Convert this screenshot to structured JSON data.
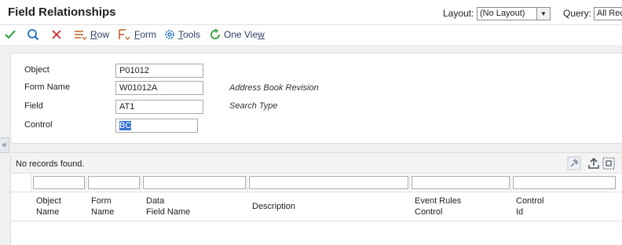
{
  "header": {
    "title": "Field Relationships",
    "layout_label": "Layout:",
    "layout_value": "(No Layout)",
    "query_label": "Query:",
    "query_value": "All Rec"
  },
  "toolbar": {
    "row_label": "Row",
    "form_label": "Form",
    "tools_label": "Tools",
    "oneview_label": "One View",
    "colors": {
      "check": "#2e9e3a",
      "search": "#1f6fc0",
      "close": "#d12b2b",
      "accent": "#c85a27"
    }
  },
  "form": {
    "fields": [
      {
        "label": "Object",
        "value": "P01012",
        "description": ""
      },
      {
        "label": "Form Name",
        "value": "W01012A",
        "description": "Address Book Revision"
      },
      {
        "label": "Field",
        "value": "AT1",
        "description": "Search Type"
      },
      {
        "label": "Control",
        "value": "BC",
        "description": ""
      }
    ]
  },
  "grid": {
    "status": "No records found.",
    "columns": [
      {
        "line1": "Object",
        "line2": "Name"
      },
      {
        "line1": "Form",
        "line2": "Name"
      },
      {
        "line1": "Data",
        "line2": "Field Name"
      },
      {
        "line1": "Description",
        "line2": ""
      },
      {
        "line1": "Event Rules",
        "line2": "Control"
      },
      {
        "line1": "Control",
        "line2": "Id"
      }
    ],
    "rows": []
  }
}
